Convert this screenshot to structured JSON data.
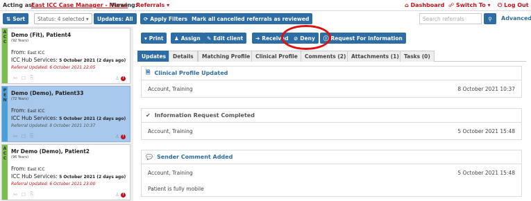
{
  "topbar": {
    "acting_as_label": "Acting as:",
    "acting_as_value": "East ICC Case Manager - Nurse",
    "viewing_label": "Viewing:",
    "viewing_value": "Referrals",
    "dashboard": "Dashboard",
    "switch_to": "Switch To",
    "log_out": "Log Out"
  },
  "toolbar": {
    "sort": "Sort",
    "status_select": "Status: 4 selected",
    "updates_all": "Updates: All",
    "apply_filters": "Apply Filters",
    "mark_cancelled": "Mark all cancelled referrals as reviewed",
    "search_placeholder": "Search referrals",
    "advanced": "Advanced"
  },
  "referrals": [
    {
      "status_letters": [
        "A",
        "C",
        "C"
      ],
      "status_color": "#7bbf4a",
      "name": "Demo (Fit), Patient4",
      "age": "(92 Years)",
      "from_label": "From:",
      "from_value": "East ICC",
      "hub_label": "ICC Hub Services:",
      "hub_value": "5 October 2021 (2 days ago)",
      "updated": "Referral Updated: 6 October 2021 22:05",
      "selected": false
    },
    {
      "status_letters": [
        "P",
        "E",
        "N"
      ],
      "status_color": "#4a9fd6",
      "name": "Demo (Demo), Patient33",
      "age": "(72 Years)",
      "from_label": "From:",
      "from_value": "East ICC",
      "hub_label": "ICC Hub Services:",
      "hub_value": "5 October 2021 (2 days ago)",
      "updated": "Referral Updated: 8 October 2021 10:37",
      "selected": true
    },
    {
      "status_letters": [
        "A",
        "C",
        "C"
      ],
      "status_color": "#7bbf4a",
      "name": "Mr Demo (Demo), Patient2",
      "age": "(96 Years)",
      "from_label": "From:",
      "from_value": "East ICC",
      "hub_label": "ICC Hub Services:",
      "hub_value": "5 October 2021 (2 days ago)",
      "updated": "Referral Updated: 6 October 2021 23:00",
      "selected": false
    }
  ],
  "actions": {
    "print": "Print",
    "assign": "Assign",
    "edit_client": "Edit client",
    "received": "Received",
    "deny": "Deny",
    "request_info": "Request For Information"
  },
  "tabs": [
    "Updates",
    "Details",
    "Matching Profile",
    "Clinical Profile",
    "Comments (2)",
    "Attachments (1)",
    "Tasks (0)"
  ],
  "updates": [
    {
      "title": "Clinical Profile Updated",
      "title_color": "#2e6da4",
      "icon": "document-icon",
      "author": "Account, Training",
      "date": "8 October 2021 10:37"
    },
    {
      "title": "Information Request Completed",
      "title_color": "#555555",
      "icon": "check-icon",
      "author": "Account, Training",
      "date": "5 October 2021 15:48"
    },
    {
      "title": "Sender Comment Added",
      "title_color": "#2e6da4",
      "icon": "comment-icon",
      "author": "Account, Training",
      "date": "5 October 2021 15:48",
      "note": "Patient is fully mobile"
    }
  ],
  "colors": {
    "primary": "#2e6da4",
    "accent_red": "#c0131b",
    "selected_card": "#a8c8ec"
  }
}
